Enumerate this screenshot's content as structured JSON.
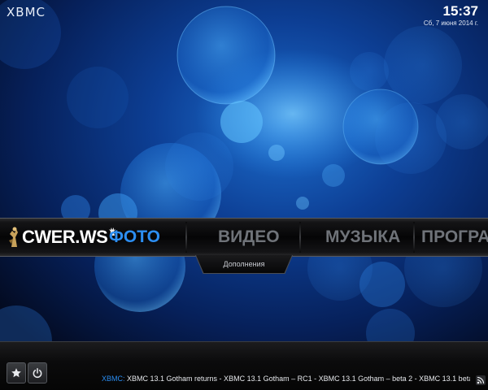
{
  "app": {
    "logo_text": "XBMC",
    "time": "15:37",
    "date": "Сб, 7 июня 2014 г."
  },
  "menu": {
    "brand": "CWER.WS",
    "items": [
      {
        "label": "ФОТО",
        "active": true
      },
      {
        "label": "ВИДЕО",
        "active": false
      },
      {
        "label": "МУЗЫКА",
        "active": false
      },
      {
        "label": "ПРОГРА",
        "active": false
      }
    ],
    "submenu_label": "Дополнения"
  },
  "bottom": {
    "buttons": [
      {
        "icon": "star-icon"
      },
      {
        "icon": "power-icon"
      }
    ],
    "rss": {
      "source": "XBMC:",
      "text": " XBMC 13.1 Gotham returns - XBMC 13.1 Gotham – RC1 - XBMC 13.1 Gotham – beta 2 - XBMC 13.1 beta1 Gotham - XB",
      "icon": "rss-icon"
    }
  },
  "colors": {
    "accent": "#2c8ef2",
    "inactive_menu": "#6f7379",
    "background": "#06122e"
  }
}
